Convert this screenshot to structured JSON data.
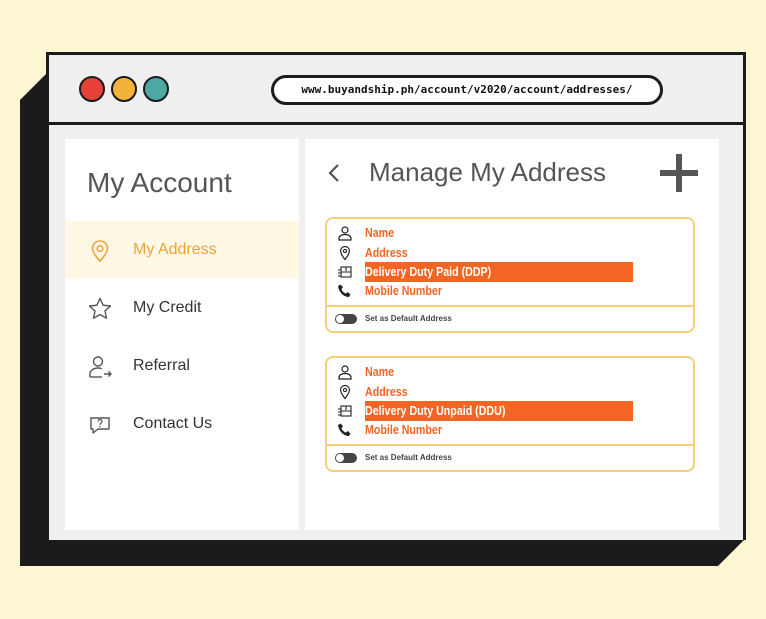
{
  "browser": {
    "url": "www.buyandship.ph/account/v2020/account/addresses/"
  },
  "sidebar": {
    "title": "My Account",
    "items": [
      {
        "label": "My Address",
        "icon": "location-pin-icon",
        "active": true
      },
      {
        "label": "My Credit",
        "icon": "star-icon",
        "active": false
      },
      {
        "label": "Referral",
        "icon": "user-share-icon",
        "active": false
      },
      {
        "label": "Contact Us",
        "icon": "chat-bubble-icon",
        "active": false
      }
    ]
  },
  "main": {
    "title": "Manage My Address",
    "cards": [
      {
        "name": "Name",
        "address": "Address",
        "duty": "Delivery Duty Paid (DDP)",
        "mobile": "Mobile Number",
        "default_label": "Set as Default Address"
      },
      {
        "name": "Name",
        "address": "Address",
        "duty": "Delivery Duty Unpaid (DDU)",
        "mobile": "Mobile Number",
        "default_label": "Set as Default Address"
      }
    ]
  },
  "colors": {
    "accent": "#f26522",
    "active_menu": "#f0a23a",
    "card_border": "#f6cf7c",
    "background": "#fdf6d2"
  }
}
